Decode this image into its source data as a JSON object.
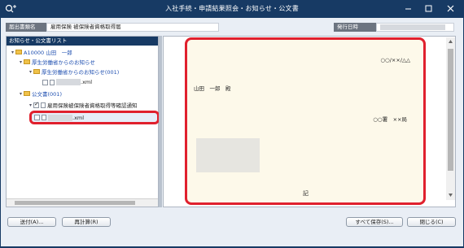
{
  "window": {
    "title": "入社手続・申請結果照会・お知らせ・公文書",
    "controls": [
      "minimize-icon",
      "maximize-icon",
      "close-icon"
    ]
  },
  "info": {
    "form_name_label": "届出書類名",
    "form_name_value": "雇用保険 被保険者資格取得届",
    "issue_date_label": "発行日時"
  },
  "tree": {
    "header": "お知らせ・公文書リスト",
    "items": [
      {
        "label": "A10000 山田　一郎"
      },
      {
        "label": "厚生労働省からのお知らせ"
      },
      {
        "label": "厚生労働省からのお知らせ(001)"
      },
      {
        "label": ".xml"
      },
      {
        "label": "公文書(001)"
      },
      {
        "label": "雇用保険被保険者資格取得等確認通知"
      },
      {
        "label": ".xml"
      }
    ]
  },
  "document": {
    "date": "○○/××/△△",
    "addressee": "山田　一郎　殿",
    "issuer": "○○署　××局",
    "ki": "記"
  },
  "buttons": {
    "send": "送付(A)...",
    "recalc": "再計算(R)",
    "save_all": "すべて保存(S)...",
    "close": "閉じる(C)"
  },
  "colors": {
    "titlebar": "#173a64",
    "highlight": "#e0202d",
    "doc_bg": "#fdf9ea"
  }
}
